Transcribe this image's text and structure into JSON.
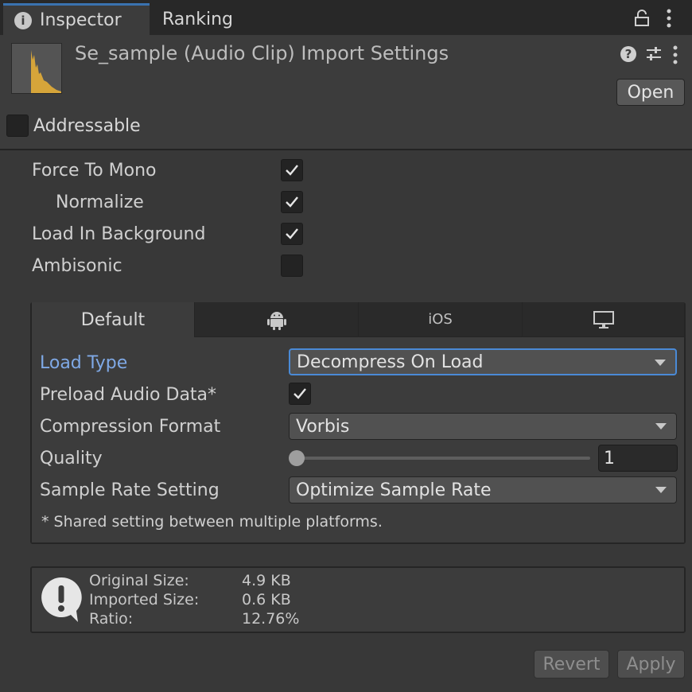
{
  "tabs": {
    "inspector_label": "Inspector",
    "ranking_label": "Ranking"
  },
  "header": {
    "title": "Se_sample (Audio Clip) Import Settings",
    "open_label": "Open",
    "addressable_label": "Addressable",
    "addressable_checked": false
  },
  "options": [
    {
      "label": "Force To Mono",
      "checked": true
    },
    {
      "label": "Normalize",
      "checked": true
    },
    {
      "label": "Load In Background",
      "checked": true
    },
    {
      "label": "Ambisonic",
      "checked": false
    }
  ],
  "platform_tabs": {
    "default_label": "Default",
    "ios_label": "iOS",
    "android_icon": "android-icon",
    "pc_icon": "monitor-icon"
  },
  "settings": {
    "load_type_label": "Load Type",
    "load_type_value": "Decompress On Load",
    "preload_label": "Preload Audio Data*",
    "preload_checked": true,
    "compression_label": "Compression Format",
    "compression_value": "Vorbis",
    "quality_label": "Quality",
    "quality_value": "1",
    "sample_rate_label": "Sample Rate Setting",
    "sample_rate_value": "Optimize Sample Rate",
    "shared_note": "* Shared setting between multiple platforms."
  },
  "info": {
    "original_label": "Original Size:",
    "original_value": "4.9 KB",
    "imported_label": "Imported Size:",
    "imported_value": "0.6 KB",
    "ratio_label": "Ratio:",
    "ratio_value": "12.76%"
  },
  "footer": {
    "revert_label": "Revert",
    "apply_label": "Apply"
  },
  "colors": {
    "accent": "#4a8ad6",
    "highlight_label": "#7fa9e6",
    "waveform": "#d6a53a"
  }
}
